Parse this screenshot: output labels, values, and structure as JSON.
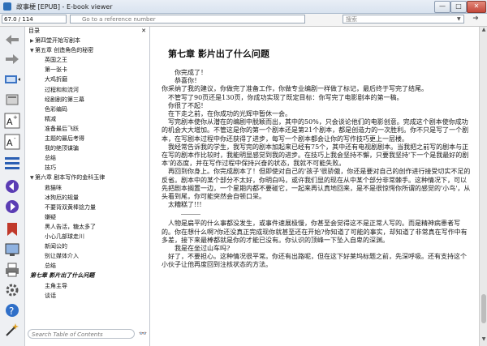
{
  "window": {
    "title": "故事梗 [EPUB] - E-book viewer",
    "min": "—",
    "max": "□",
    "close": "✕"
  },
  "toolbar": {
    "position": "67.0 / 114",
    "reference_placeholder": "Go to a reference number",
    "search_placeholder": "搜索",
    "search_drop": "▼",
    "search_go": "➜"
  },
  "left_toolbar_icons": [
    "back-arrow-icon",
    "forward-arrow-icon",
    "tablet-icon",
    "book-icon",
    "font-larger-icon",
    "font-smaller-icon",
    "table-of-contents-icon",
    "previous-icon",
    "next-icon",
    "bookmark-icon",
    "fullscreen-icon",
    "print-icon",
    "preferences-icon",
    "help-icon",
    "magic-icon"
  ],
  "toc": {
    "header": "目录",
    "close": "✕",
    "items": [
      {
        "indent": 1,
        "arrow": "▶",
        "label": "第四堂开始写剧本"
      },
      {
        "indent": 1,
        "arrow": "▼",
        "label": "第五章 创造角色的秘密"
      },
      {
        "indent": 2,
        "label": "英国之王"
      },
      {
        "indent": 2,
        "label": "第一张卡"
      },
      {
        "indent": 2,
        "label": "大鸡折磨"
      },
      {
        "indent": 2,
        "label": "过程和和流河"
      },
      {
        "indent": 2,
        "label": "经剧剧的第三幕"
      },
      {
        "indent": 2,
        "label": "色彩编码"
      },
      {
        "indent": 2,
        "label": "精减"
      },
      {
        "indent": 2,
        "label": "准备最后飞跃"
      },
      {
        "indent": 2,
        "label": "主题的最后考得"
      },
      {
        "indent": 2,
        "label": "我的绝顶谋骗"
      },
      {
        "indent": 2,
        "label": "总结"
      },
      {
        "indent": 2,
        "label": "技巧"
      },
      {
        "indent": 1,
        "arrow": "▼",
        "label": "第六章 剧本写作的金科玉律"
      },
      {
        "indent": 2,
        "label": "救猫咪"
      },
      {
        "indent": 2,
        "label": "冰狗厄的规量"
      },
      {
        "indent": 2,
        "label": "不要背双黄棒捻力量"
      },
      {
        "indent": 2,
        "label": "嫌疑"
      },
      {
        "indent": 2,
        "label": "黑人告活，糖太多了"
      },
      {
        "indent": 2,
        "label": "小心几部球走川"
      },
      {
        "indent": 2,
        "label": "新闻公的"
      },
      {
        "indent": 2,
        "label": "别让媒体介入"
      },
      {
        "indent": 2,
        "label": "总结"
      },
      {
        "indent": 1,
        "label": "第七章 影片出了什么问题",
        "active": true
      },
      {
        "indent": 2,
        "label": "主角主导"
      },
      {
        "indent": 2,
        "label": "谈话"
      }
    ],
    "search_placeholder": "Search Table of Contents",
    "search_btn": "👓"
  },
  "reader": {
    "chapter_title": "第七章 影片出了什么问题",
    "paragraphs_a": [
      "你完成了！",
      "恭喜你！",
      "你采纳了我的建议，你做完了准备工作，你做专业编剧一样做了标记，最后终于写完了结尾。",
      "不管写了90页还是130页，你成功实现了既定目标：你写完了电影剧本的第一稿。",
      "你很了不起！",
      "在下走之前，在你成功的光辉中暂休一会。",
      "写完剧本使你从潜在的编剧中脱颖而出，其中的50%，只会谈论他们的电影创意。完成这个剧本使你成功的机会大大增加。不管这是你的第一个剧本还是第21个剧本，都是创造力的一次胜利。你不只是写了一个剧本，在写剧本过程中你还获得了进步，每写一个剧本都会让你的写作技巧更上一层楼。",
      "我经常告诉我的学生，我写完的剧本加起来已经有75个，其中还有电视剧剧本。当我把之前写的剧本与正在写的剧本作比较时，我能明显感觉到我的进步。在技巧上我会坚持不懈，只要我坚持'下一个是我最好的剧本'的态度，并在写作过程中保持兴奋的状态，我就不可能失败。",
      "再回到你身上。你完成剧本了！但即使对自己的'孩子'很骄傲，你还是要对自己的创作进行接受切实不足的反省。剧本中的某个部分不太好，你明白吗，或许我们显的现在从中某个部分非常棘手。这种情况下，可以先把剧本搁置一边，一个星期内都不要碰它，一起来再认真地回来，是不是很惊愕你所谓的感觉的'小鸟'，从头看到尾，你可能突然会自顿口呆。",
      "太糟糕了!!!"
    ],
    "paragraphs_b": [
      "人物是扁平的什么事都没发生，或事件速展极慢，你甚至会觉得这不是正常人写的。而是精神病患者写的。你在想什么啊?你还没真正完成现你就甚至还在开始?你知道了可能的事实，却知道了非常真在写作中有多差，接下来最棒都就是你的才能已没有。你认识的顶峰一下坠入自卑的深渊。",
      "我是在坐过山车吗?",
      "好了，不要担心。这种情况很平常。你还有出路呢，但在这下好莱坞标题之前，先深呼吸。还有支持这个小伙子让他再度回到注核状态的方法。"
    ]
  }
}
